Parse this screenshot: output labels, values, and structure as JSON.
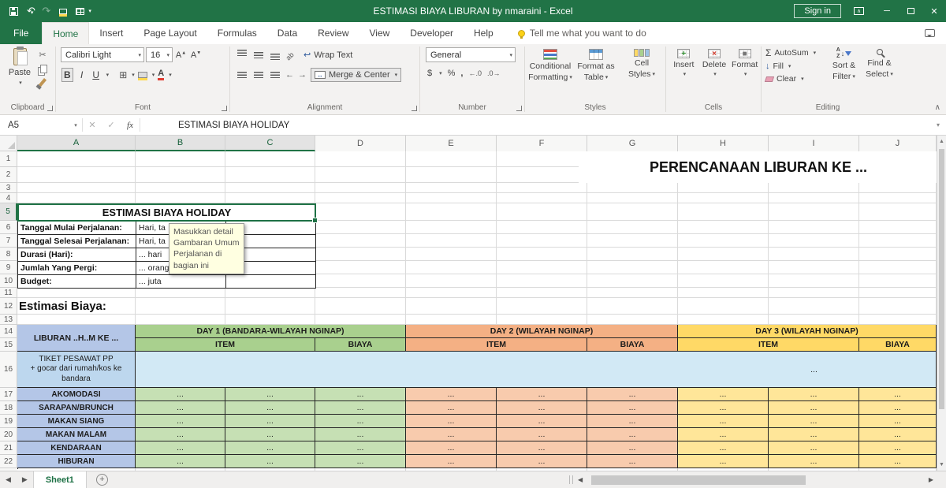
{
  "titlebar": {
    "title": "ESTIMASI BIAYA LIBURAN by nmaraini - Excel",
    "sign_in": "Sign in"
  },
  "tabs": [
    "File",
    "Home",
    "Insert",
    "Page Layout",
    "Formulas",
    "Data",
    "Review",
    "View",
    "Developer",
    "Help"
  ],
  "tell_me": "Tell me what you want to do",
  "ribbon": {
    "clipboard": {
      "label": "Clipboard",
      "paste": "Paste"
    },
    "font": {
      "label": "Font",
      "font_name": "Calibri Light",
      "font_size": "16",
      "bold": "B",
      "italic": "I",
      "underline": "U"
    },
    "alignment": {
      "label": "Alignment",
      "wrap_text": "Wrap Text",
      "merge_center": "Merge & Center"
    },
    "number": {
      "label": "Number",
      "format": "General"
    },
    "styles": {
      "label": "Styles",
      "buttons": [
        [
          "Conditional",
          "Formatting"
        ],
        [
          "Format as",
          "Table"
        ],
        [
          "Cell",
          "Styles"
        ]
      ]
    },
    "cells": {
      "label": "Cells",
      "buttons": [
        "Insert",
        "Delete",
        "Format"
      ]
    },
    "editing": {
      "label": "Editing",
      "autosum": "AutoSum",
      "fill": "Fill",
      "clear": "Clear",
      "sort": [
        "Sort &",
        "Filter"
      ],
      "find": [
        "Find &",
        "Select"
      ]
    }
  },
  "formula_bar": {
    "name_box": "A5",
    "fx": "fx",
    "formula": "ESTIMASI BIAYA HOLIDAY"
  },
  "grid": {
    "columns": [
      "A",
      "B",
      "C",
      "D",
      "E",
      "F",
      "G",
      "H",
      "I",
      "J"
    ],
    "rows": [
      "1",
      "2",
      "3",
      "4",
      "5",
      "6",
      "7",
      "8",
      "9",
      "10",
      "11",
      "12",
      "13",
      "14",
      "15",
      "16",
      "17",
      "18",
      "19",
      "20",
      "21",
      "22"
    ]
  },
  "sheet": {
    "banner": "PERENCANAAN LIBURAN KE ...",
    "info_title": "ESTIMASI BIAYA HOLIDAY",
    "info_rows": [
      {
        "label": "Tanggal Mulai Perjalanan:",
        "value": "Hari, ta"
      },
      {
        "label": "Tanggal Selesai Perjalanan:",
        "value": "Hari, ta"
      },
      {
        "label": "Durasi (Hari):",
        "value": "... hari"
      },
      {
        "label": "Jumlah Yang Pergi:",
        "value": "... orang"
      },
      {
        "label": "Budget:",
        "value": "... juta"
      }
    ],
    "tooltip": "Masukkan detail Gambaran Umum Perjalanan di bagian ini",
    "section_title": "Estimasi Biaya:",
    "cost_table": {
      "corner": "LIBURAN ..H..M KE ...",
      "day_headers": [
        "DAY 1 (BANDARA-WILAYAH NGINAP)",
        "DAY 2 (WILAYAH NGINAP)",
        "DAY 3 (WILAYAH NGINAP)"
      ],
      "item_label": "ITEM",
      "biaya_label": "BIAYA",
      "flight_row": {
        "label_lines": [
          "TIKET PESAWAT PP",
          "+ gocar dari rumah/kos ke",
          "bandara"
        ],
        "value": "..."
      },
      "categories": [
        "AKOMODASI",
        "SARAPAN/BRUNCH",
        "MAKAN SIANG",
        "MAKAN MALAM",
        "KENDARAAN",
        "HIBURAN"
      ],
      "cell_value": "..."
    }
  },
  "sheet_tabs": {
    "active": "Sheet1"
  },
  "colors": {
    "accent": "#217346",
    "day1_header": "#a9d08e",
    "day1_cell": "#c6e0b4",
    "day2_header": "#f4b084",
    "day2_cell": "#f8cbad",
    "day3_header": "#ffd966",
    "day3_cell": "#ffe699",
    "row_label": "#b4c6e7",
    "flight_label": "#bdd7ee",
    "flight_band": "#d2e9f5"
  }
}
